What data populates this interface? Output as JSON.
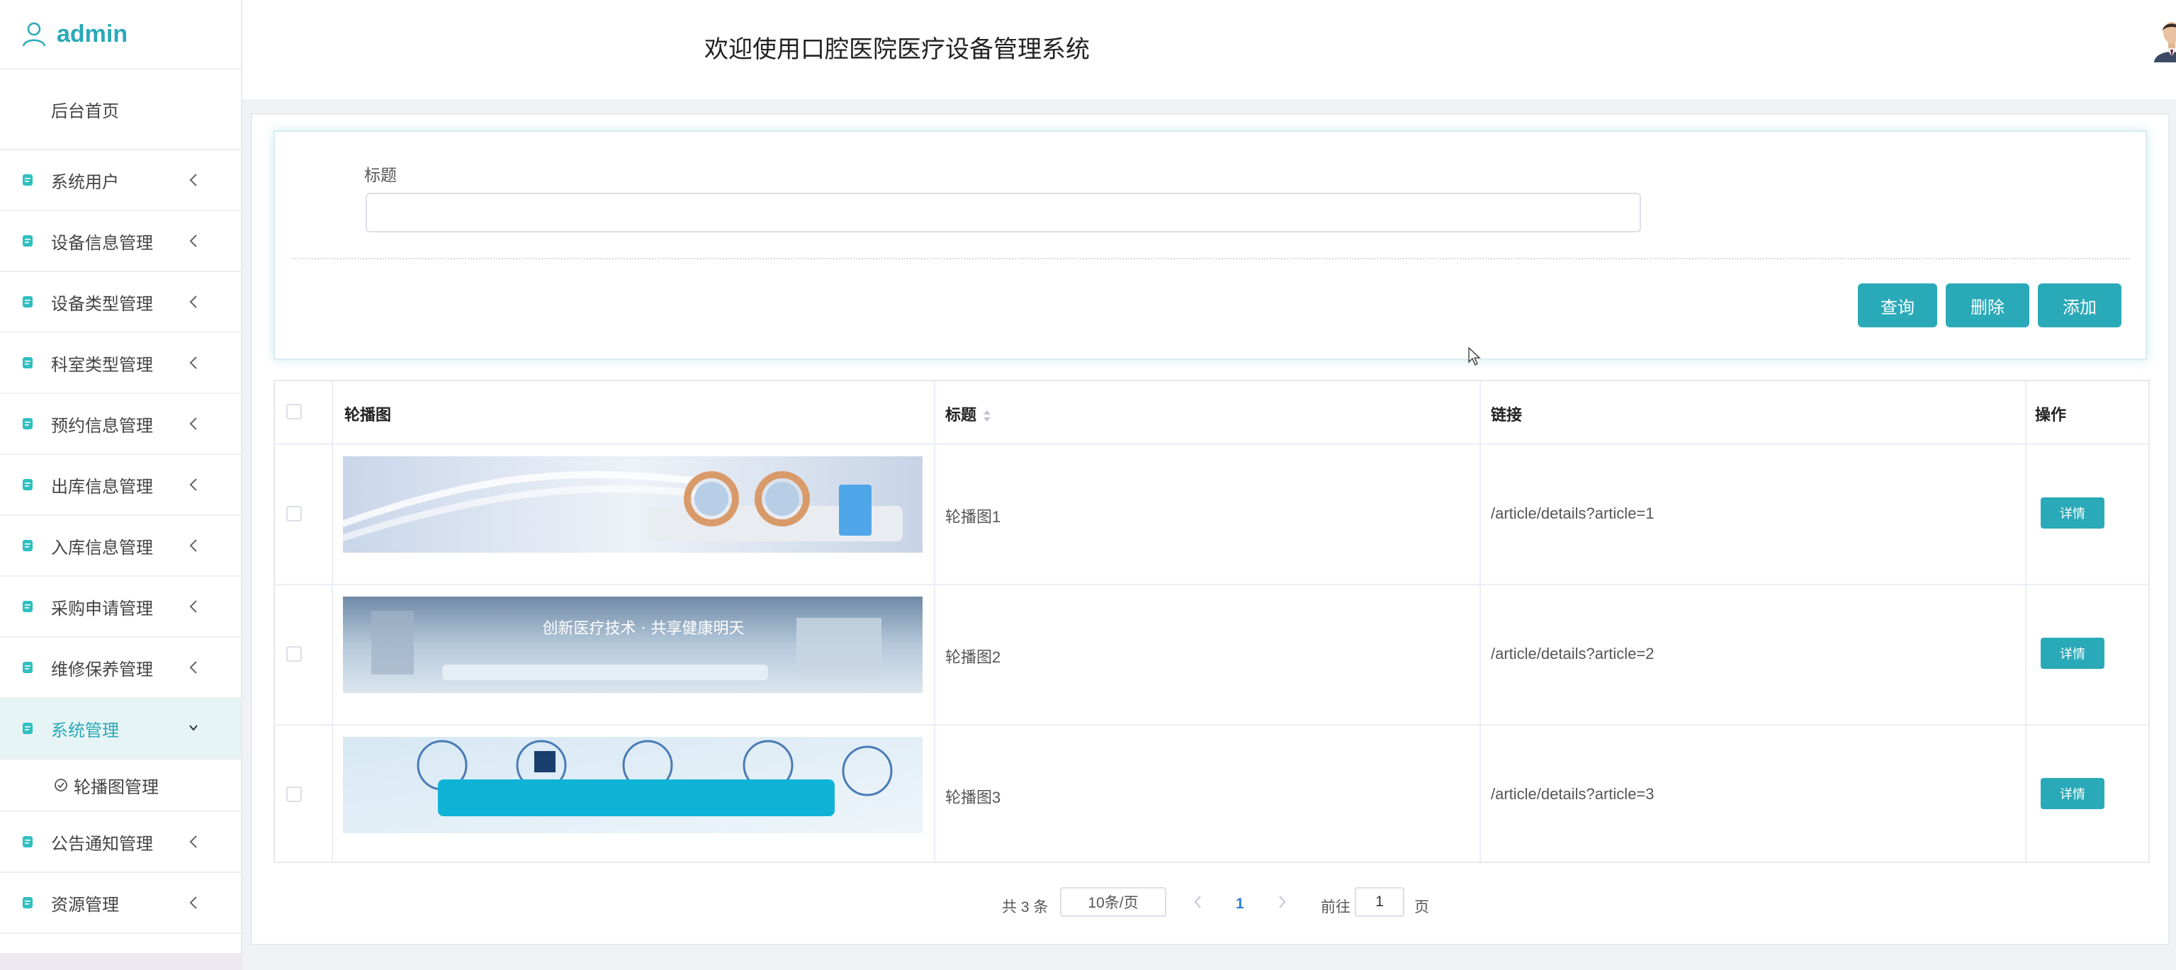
{
  "sidebar": {
    "brand": "admin",
    "home": "后台首页",
    "items": [
      {
        "label": "系统用户"
      },
      {
        "label": "设备信息管理"
      },
      {
        "label": "设备类型管理"
      },
      {
        "label": "科室类型管理"
      },
      {
        "label": "预约信息管理"
      },
      {
        "label": "出库信息管理"
      },
      {
        "label": "入库信息管理"
      },
      {
        "label": "采购申请管理"
      },
      {
        "label": "维修保养管理"
      },
      {
        "label": "系统管理"
      },
      {
        "label": "公告通知管理"
      },
      {
        "label": "资源管理"
      }
    ],
    "submenu": {
      "label": "轮播图管理"
    }
  },
  "header": {
    "title": "欢迎使用口腔医院医疗设备管理系统"
  },
  "search": {
    "label": "标题",
    "value": "",
    "placeholder": "",
    "buttons": {
      "search": "查询",
      "delete": "删除",
      "add": "添加"
    }
  },
  "table": {
    "columns": {
      "image": "轮播图",
      "title": "标题",
      "link": "链接",
      "action": "操作"
    },
    "rows": [
      {
        "title": "轮播图1",
        "link": "/article/details?article=1",
        "action": "详情"
      },
      {
        "title": "轮播图2",
        "link": "/article/details?article=2",
        "action": "详情",
        "banner_text": "创新医疗技术 · 共享健康明天"
      },
      {
        "title": "轮播图3",
        "link": "/article/details?article=3",
        "action": "详情"
      }
    ]
  },
  "pagination": {
    "total": "共 3 条",
    "page_size": "10条/页",
    "current": "1",
    "goto_label": "前往",
    "goto_value": "1",
    "unit": "页"
  },
  "colors": {
    "accent": "#2aa9b8",
    "active_bg": "#e6f4f5"
  }
}
